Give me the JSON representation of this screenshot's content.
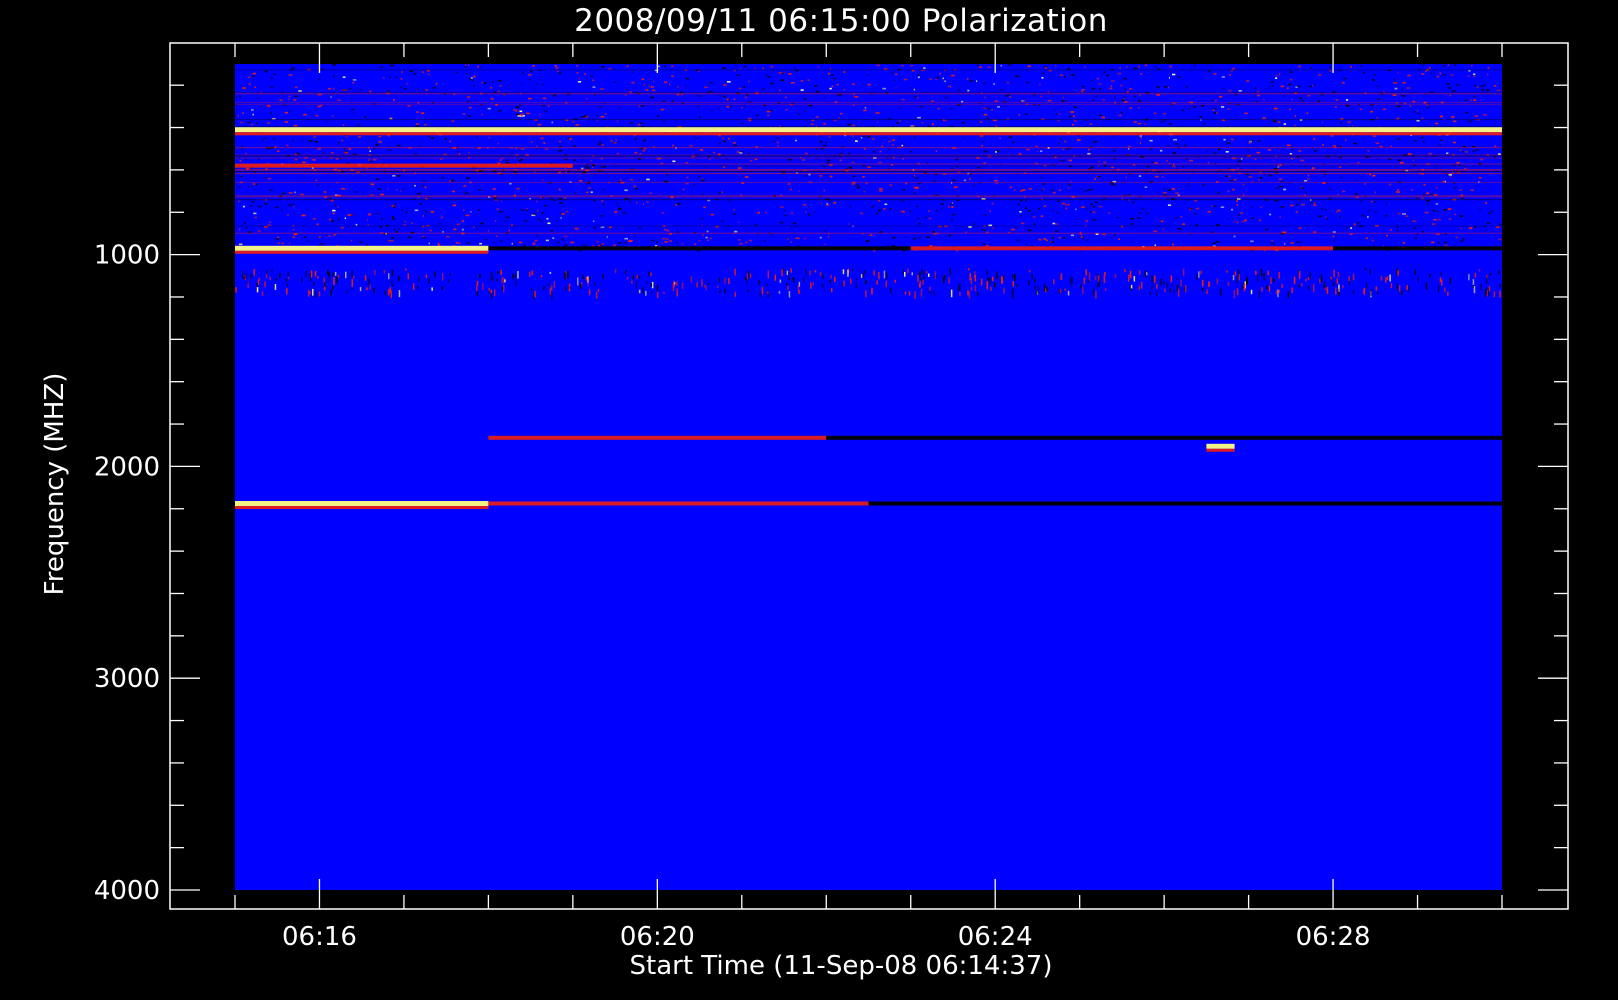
{
  "chart_data": {
    "type": "heatmap",
    "title": "2008/09/11 06:15:00 Polarization",
    "xlabel": "Start Time (11-Sep-08 06:14:37)",
    "ylabel": "Frequency (MHZ)",
    "x_range_minutes": [
      0,
      15
    ],
    "x_start": "06:15:00",
    "x_end": "06:30:00",
    "y_range_mhz": [
      100,
      4000
    ],
    "x_ticks": [
      "06:16",
      "06:20",
      "06:24",
      "06:28"
    ],
    "x_tick_values": [
      "06:16",
      "06:20",
      "06:24",
      "06:28"
    ],
    "y_ticks": [
      "1000",
      "2000",
      "3000",
      "4000"
    ],
    "y_tick_values": [
      1000,
      2000,
      3000,
      4000
    ],
    "y_axis_inverted": true,
    "colors": {
      "background": "#0000ff",
      "low": "#000000",
      "mid": "#ff2000",
      "high": "#ffff80",
      "frame": "#ffffff",
      "page": "#000000"
    },
    "features": [
      {
        "kind": "noise_band",
        "freq_from": 100,
        "freq_to": 980,
        "strength": 0.9
      },
      {
        "kind": "line",
        "freq": 410,
        "color": "high",
        "from": "06:15:00",
        "to": "06:30:00"
      },
      {
        "kind": "line",
        "freq": 580,
        "color": "mid",
        "from": "06:15:00",
        "to": "06:19:00"
      },
      {
        "kind": "line",
        "freq": 970,
        "color": "high",
        "from": "06:15:00",
        "to": "06:18:00"
      },
      {
        "kind": "line",
        "freq": 970,
        "color": "low",
        "from": "06:18:00",
        "to": "06:23:00"
      },
      {
        "kind": "line",
        "freq": 970,
        "color": "mid",
        "from": "06:23:00",
        "to": "06:28:00"
      },
      {
        "kind": "line",
        "freq": 970,
        "color": "low",
        "from": "06:28:00",
        "to": "06:30:00"
      },
      {
        "kind": "speckle",
        "freq": 1120,
        "from": "06:15:00",
        "to": "06:30:00"
      },
      {
        "kind": "line",
        "freq": 1865,
        "color": "mid",
        "from": "06:18:00",
        "to": "06:22:00"
      },
      {
        "kind": "line",
        "freq": 1865,
        "color": "low",
        "from": "06:22:00",
        "to": "06:30:00"
      },
      {
        "kind": "line",
        "freq": 1905,
        "color": "high",
        "from": "06:26:30",
        "to": "06:26:50"
      },
      {
        "kind": "line",
        "freq": 2175,
        "color": "high",
        "from": "06:15:00",
        "to": "06:18:00"
      },
      {
        "kind": "line",
        "freq": 2175,
        "color": "mid",
        "from": "06:18:00",
        "to": "06:22:30"
      },
      {
        "kind": "line",
        "freq": 2175,
        "color": "low",
        "from": "06:22:30",
        "to": "06:30:00"
      }
    ]
  }
}
